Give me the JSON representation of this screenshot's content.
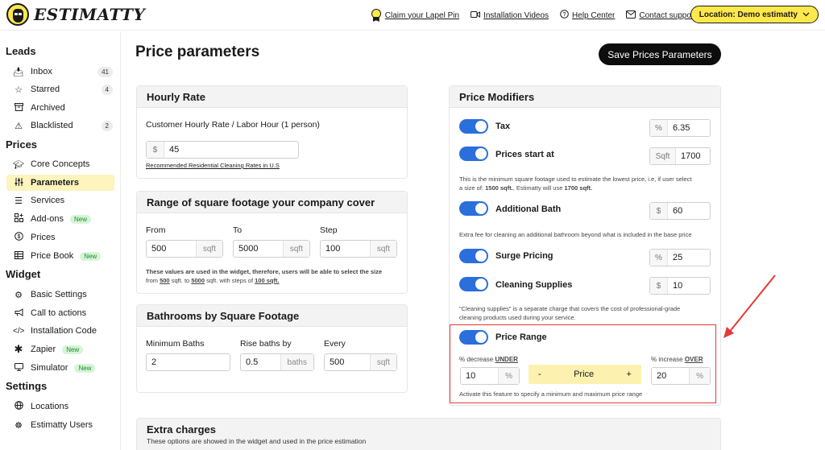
{
  "header": {
    "logo_text": "ESTIMATTY",
    "links": [
      {
        "label": "Claim your Lapel Pin"
      },
      {
        "label": "Installation Videos"
      },
      {
        "label": "Help Center"
      },
      {
        "label": "Contact support"
      }
    ],
    "location_label": "Location: Demo estimatty"
  },
  "sidebar": {
    "leads_title": "Leads",
    "leads": [
      {
        "label": "Inbox",
        "count": "41"
      },
      {
        "label": "Starred",
        "count": "4"
      },
      {
        "label": "Archived"
      },
      {
        "label": "Blacklisted",
        "count": "2"
      }
    ],
    "prices_title": "Prices",
    "prices": [
      {
        "label": "Core Concepts"
      },
      {
        "label": "Parameters"
      },
      {
        "label": "Services"
      },
      {
        "label": "Add-ons",
        "badge": "New"
      },
      {
        "label": "Prices"
      },
      {
        "label": "Price Book",
        "badge": "New"
      }
    ],
    "widget_title": "Widget",
    "widget": [
      {
        "label": "Basic Settings"
      },
      {
        "label": "Call to actions"
      },
      {
        "label": "Installation Code"
      },
      {
        "label": "Zapier",
        "badge": "New"
      },
      {
        "label": "Simulator",
        "badge": "New"
      }
    ],
    "settings_title": "Settings",
    "settings": [
      {
        "label": "Locations"
      },
      {
        "label": "Estimatty Users"
      }
    ]
  },
  "main": {
    "title": "Price parameters",
    "save_label": "Save Prices Parameters",
    "hourly": {
      "title": "Hourly Rate",
      "label": "Customer Hourly Rate / Labor Hour (1 person)",
      "prefix": "$",
      "value": "45",
      "link": "Recommended Residential Cleaning Rates in U.S"
    },
    "range": {
      "title": "Range of square footage your company cover",
      "from_label": "From",
      "from_value": "500",
      "to_label": "To",
      "to_value": "5000",
      "step_label": "Step",
      "step_value": "100",
      "unit": "sqft",
      "note_1": "These values are used in the widget, therefore, users will be able to select the size",
      "note_2_prefix": "from",
      "note_from": "500",
      "note_2_mid": "sqft. to",
      "note_to": "5000",
      "note_2_mid2": "sqft. with steps of",
      "note_step": "100 sqft."
    },
    "bathrooms": {
      "title": "Bathrooms by Square Footage",
      "min_label": "Minimum Baths",
      "min_value": "2",
      "rise_label": "Rise baths by",
      "rise_value": "0.5",
      "rise_unit": "baths",
      "every_label": "Every",
      "every_value": "500",
      "every_unit": "sqft"
    },
    "extra": {
      "title": "Extra charges",
      "subtitle": "These options are showed in the widget and used in the price estimation"
    },
    "modifiers": {
      "title": "Price Modifiers",
      "tax_label": "Tax",
      "tax_prefix": "%",
      "tax_value": "6.35",
      "start_label": "Prices start at",
      "start_prefix": "Sqft",
      "start_value": "1700",
      "start_note_1": "This is the minimum square footage used to estimate the lowest price, i.e, if user select",
      "start_note_2a": "a size of:",
      "start_note_2b": "1500 sqft.",
      "start_note_2c": ", Estimatty will use",
      "start_note_2d": "1700 sqft.",
      "bath_label": "Additional Bath",
      "bath_prefix": "$",
      "bath_value": "60",
      "bath_note": "Extra fee for cleaning an additional bathroom beyond what is included in the base price",
      "surge_label": "Surge Pricing",
      "surge_prefix": "%",
      "surge_value": "25",
      "supplies_label": "Cleaning Supplies",
      "supplies_prefix": "$",
      "supplies_value": "10",
      "supplies_note_1": "\"Cleaning supplies\" is a separate charge that covers the cost of professional-grade",
      "supplies_note_2": "cleaning products used during your service.",
      "range_label": "Price Range",
      "decrease_label": "% decrease",
      "decrease_word": "UNDER",
      "increase_label": "% increase",
      "increase_word": "OVER",
      "decrease_value": "10",
      "increase_value": "20",
      "pct": "%",
      "pill_minus": "-",
      "pill_label": "Price",
      "pill_plus": "+",
      "range_note": "Activate this feature to specify a minimum and maximum price range"
    }
  },
  "colors": {
    "accent": "#ffe94a",
    "toggle": "#2a6fdb",
    "highlight": "#e53935",
    "pill": "#fdf1b0"
  }
}
